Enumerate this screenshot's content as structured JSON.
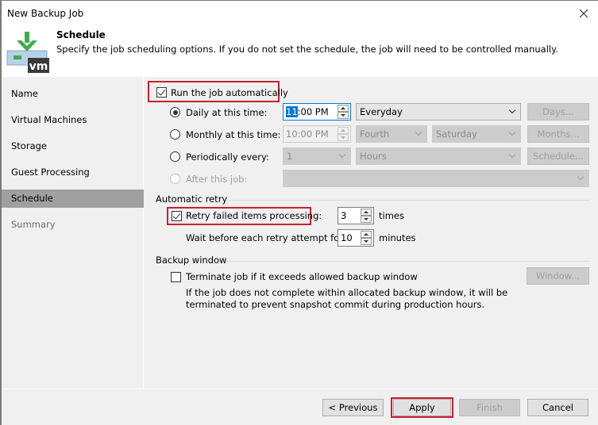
{
  "window": {
    "title": "New Backup Job",
    "close_icon": "close-icon"
  },
  "header": {
    "icon": "vm-backup-icon",
    "title": "Schedule",
    "description": "Specify the job scheduling options. If you do not set the schedule, the job will need to be controlled manually."
  },
  "sidebar": {
    "items": [
      {
        "label": "Name",
        "state": "normal"
      },
      {
        "label": "Virtual Machines",
        "state": "normal"
      },
      {
        "label": "Storage",
        "state": "normal"
      },
      {
        "label": "Guest Processing",
        "state": "normal"
      },
      {
        "label": "Schedule",
        "state": "active"
      },
      {
        "label": "Summary",
        "state": "disabled"
      }
    ]
  },
  "schedule": {
    "run_automatically": {
      "label": "Run the job automatically",
      "checked": true
    },
    "daily": {
      "label": "Daily at this time:",
      "selected": true,
      "time_selected_part": "11",
      "time_rest": ":00 PM",
      "frequency": "Everyday",
      "button": "Days..."
    },
    "monthly": {
      "label": "Monthly at this time:",
      "selected": false,
      "time": "10:00 PM",
      "week": "Fourth",
      "day": "Saturday",
      "button": "Months..."
    },
    "periodically": {
      "label": "Periodically every:",
      "selected": false,
      "value": "1",
      "unit": "Hours",
      "button": "Schedule..."
    },
    "after_job": {
      "label": "After this job:",
      "selected": false,
      "value": ""
    }
  },
  "automatic_retry": {
    "group_label": "Automatic retry",
    "retry": {
      "label": "Retry failed items processing:",
      "checked": true,
      "value": "3",
      "unit": "times"
    },
    "wait": {
      "label": "Wait before each retry attempt for:",
      "value": "10",
      "unit": "minutes"
    }
  },
  "backup_window": {
    "group_label": "Backup window",
    "terminate": {
      "label": "Terminate job if it exceeds allowed backup window",
      "checked": false
    },
    "description_line1": "If the job does not complete within allocated backup window, it will be",
    "description_line2": "terminated to prevent snapshot commit during production hours.",
    "button": "Window..."
  },
  "footer": {
    "previous": "< Previous",
    "apply": "Apply",
    "finish": "Finish",
    "cancel": "Cancel"
  },
  "colors": {
    "highlight": "#c8202f",
    "selection": "#0078d7",
    "sidebar_active": "#a0a0a0",
    "icon_green": "#3fae49",
    "icon_dark": "#3a3a3a"
  }
}
